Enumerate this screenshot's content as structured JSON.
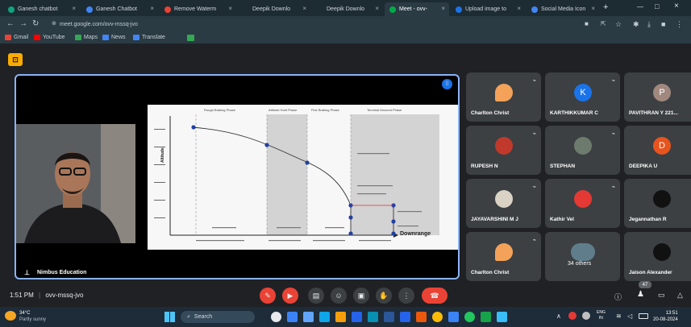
{
  "browser": {
    "tabs": [
      {
        "label": "Ganesh chatbot",
        "color": "#10a37f"
      },
      {
        "label": "Ganesh Chatbot",
        "color": "#4285f4"
      },
      {
        "label": "Remove Waterm",
        "color": "#ea4335"
      },
      {
        "label": "Deepik Downlo",
        "color": "#1d2b33"
      },
      {
        "label": "Deepik Downlo",
        "color": "#1d2b33"
      },
      {
        "label": "Meet - ovv-",
        "color": "#00ac47",
        "active": true
      },
      {
        "label": "Upload image to",
        "color": "#1a73e8"
      },
      {
        "label": "Social Media Icon",
        "color": "#4285f4"
      }
    ],
    "new_tab_label": "+",
    "url": "meet.google.com/ovv-mssq-jvo",
    "bookmarks": [
      {
        "label": "Gmail",
        "color": "#ea4335"
      },
      {
        "label": "YouTube",
        "color": "#ff0000"
      },
      {
        "label": "Maps",
        "color": "#34a853"
      },
      {
        "label": "News",
        "color": "#4285f4"
      },
      {
        "label": "Translate",
        "color": "#4285f4"
      }
    ]
  },
  "main_tile": {
    "presenter_name": "Nimbus Education"
  },
  "slide": {
    "phases": [
      "Rough Braking Phase",
      "Attitude Hold Phase",
      "Fine Braking Phase",
      "Terminal Descent Phase"
    ],
    "y_axis_label": "Altitude",
    "x_axis_label": "Downrange"
  },
  "participants": [
    {
      "name": "Charlton Christ",
      "type": "logo",
      "color": "#f4a259"
    },
    {
      "name": "KARTHIKKUMAR C",
      "type": "letter",
      "letter": "K",
      "color": "#1a73e8"
    },
    {
      "name": "PAVITHRAN Y 221...",
      "type": "letter",
      "letter": "P",
      "color": "#a1887f"
    },
    {
      "name": "RUPESH N",
      "type": "photo",
      "color": "#c0392b"
    },
    {
      "name": "STEPHAN",
      "type": "photo",
      "color": "#6d7b6e"
    },
    {
      "name": "DEEPIKA U",
      "type": "letter",
      "letter": "D",
      "color": "#e8541e"
    },
    {
      "name": "JAYAVARSHINI M J",
      "type": "photo",
      "color": "#d9d2c5"
    },
    {
      "name": "Kathir Vel",
      "type": "photo",
      "color": "#e53935"
    },
    {
      "name": "Jegannathan R",
      "type": "photo",
      "color": "#111111"
    },
    {
      "name": "Charlton Christ",
      "type": "logo",
      "color": "#f4a259"
    },
    {
      "name": "34 others",
      "type": "others",
      "color": "#607d8b"
    },
    {
      "name": "Jaison Alexander",
      "type": "photo",
      "color": "#111111"
    }
  ],
  "meeting": {
    "time": "1:51 PM",
    "separator": "|",
    "code": "ovv-mssq-jvo",
    "people_count": "47"
  },
  "taskbar": {
    "weather_temp": "34°C",
    "weather_desc": "Partly sunny",
    "search_label": "Search",
    "lang_top": "ENG",
    "lang_bottom": "IN",
    "clock_time": "13:51",
    "clock_date": "20-08-2024"
  }
}
